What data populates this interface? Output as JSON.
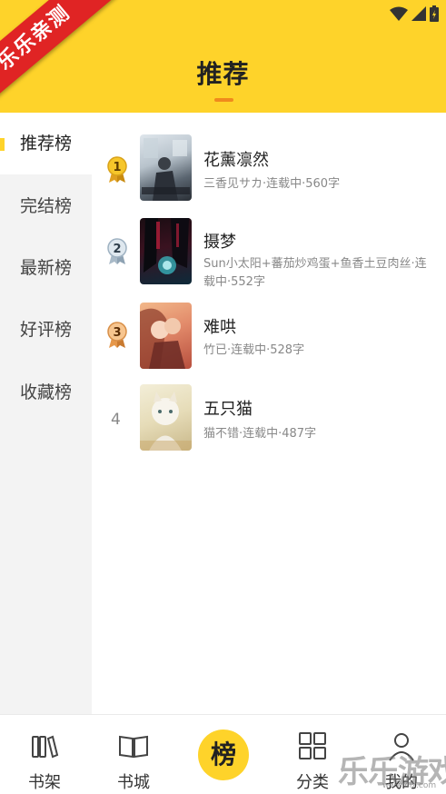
{
  "header": {
    "title": "推荐"
  },
  "ribbon": {
    "text": "乐乐亲测"
  },
  "sidebar": {
    "items": [
      {
        "label": "推荐榜",
        "active": true
      },
      {
        "label": "完结榜",
        "active": false
      },
      {
        "label": "最新榜",
        "active": false
      },
      {
        "label": "好评榜",
        "active": false
      },
      {
        "label": "收藏榜",
        "active": false
      }
    ]
  },
  "books": [
    {
      "rank": "1",
      "title": "花薰凛然",
      "meta": "三香见サカ·连载中·560字",
      "medal": "gold"
    },
    {
      "rank": "2",
      "title": "摄梦",
      "meta": "Sun小太阳+蕃茄炒鸡蛋+鱼香土豆肉丝·连载中·552字",
      "medal": "silver"
    },
    {
      "rank": "3",
      "title": "难哄",
      "meta": "竹已·连载中·528字",
      "medal": "bronze"
    },
    {
      "rank": "4",
      "title": "五只猫",
      "meta": "猫不错·连载中·487字",
      "medal": "none"
    }
  ],
  "bottom_nav": {
    "items": [
      {
        "label": "书架",
        "icon": "bookshelf-icon"
      },
      {
        "label": "书城",
        "icon": "book-open-icon"
      },
      {
        "label": "榜",
        "icon": "ranking-icon"
      },
      {
        "label": "分类",
        "icon": "grid-icon"
      },
      {
        "label": "我的",
        "icon": "user-icon"
      }
    ]
  },
  "watermark": {
    "text": "乐乐游戏",
    "sub": "www.4lz.com"
  },
  "colors": {
    "accent": "#fed32a",
    "underline": "#f08a1c",
    "ribbon": "#e02424"
  }
}
